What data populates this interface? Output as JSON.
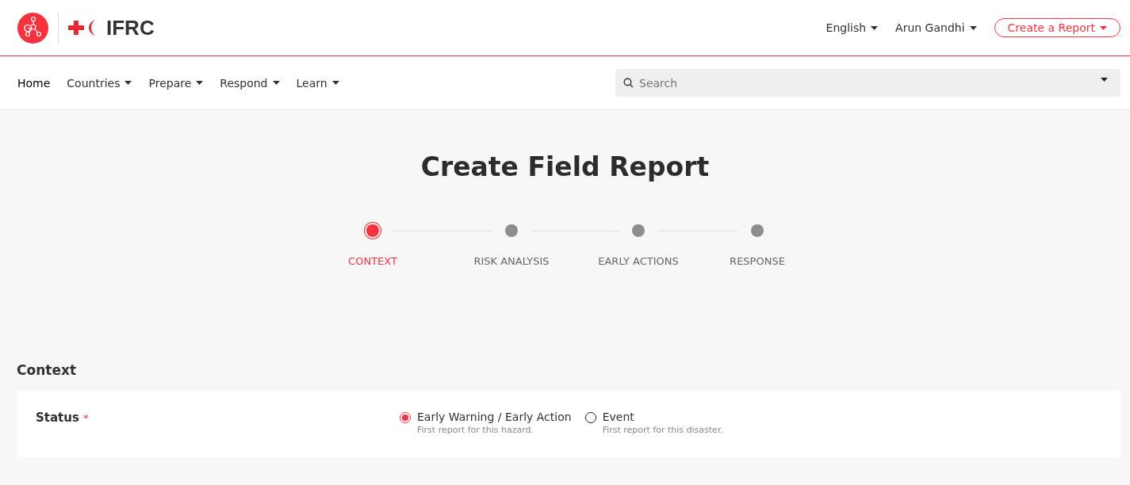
{
  "header": {
    "logo_letter": "G",
    "brand": "IFRC",
    "language": "English",
    "user": "Arun Gandhi",
    "create_button": "Create a Report"
  },
  "nav": {
    "items": [
      {
        "label": "Home",
        "has_menu": false
      },
      {
        "label": "Countries",
        "has_menu": true
      },
      {
        "label": "Prepare",
        "has_menu": true
      },
      {
        "label": "Respond",
        "has_menu": true
      },
      {
        "label": "Learn",
        "has_menu": true
      }
    ],
    "search": {
      "placeholder": "Search"
    }
  },
  "page_title": "Create Field Report",
  "steps": [
    {
      "label": "CONTEXT",
      "selected": true
    },
    {
      "label": "RISK ANALYSIS",
      "selected": false
    },
    {
      "label": "EARLY ACTIONS",
      "selected": false
    },
    {
      "label": "RESPONSE",
      "selected": false
    }
  ],
  "section": {
    "title": "Context",
    "field": {
      "label": "Status",
      "required_mark": "*",
      "options": [
        {
          "label": "Early Warning / Early Action",
          "hint": "First report for this hazard.",
          "selected": true
        },
        {
          "label": "Event",
          "hint": "First report for this disaster.",
          "selected": false
        }
      ]
    }
  }
}
